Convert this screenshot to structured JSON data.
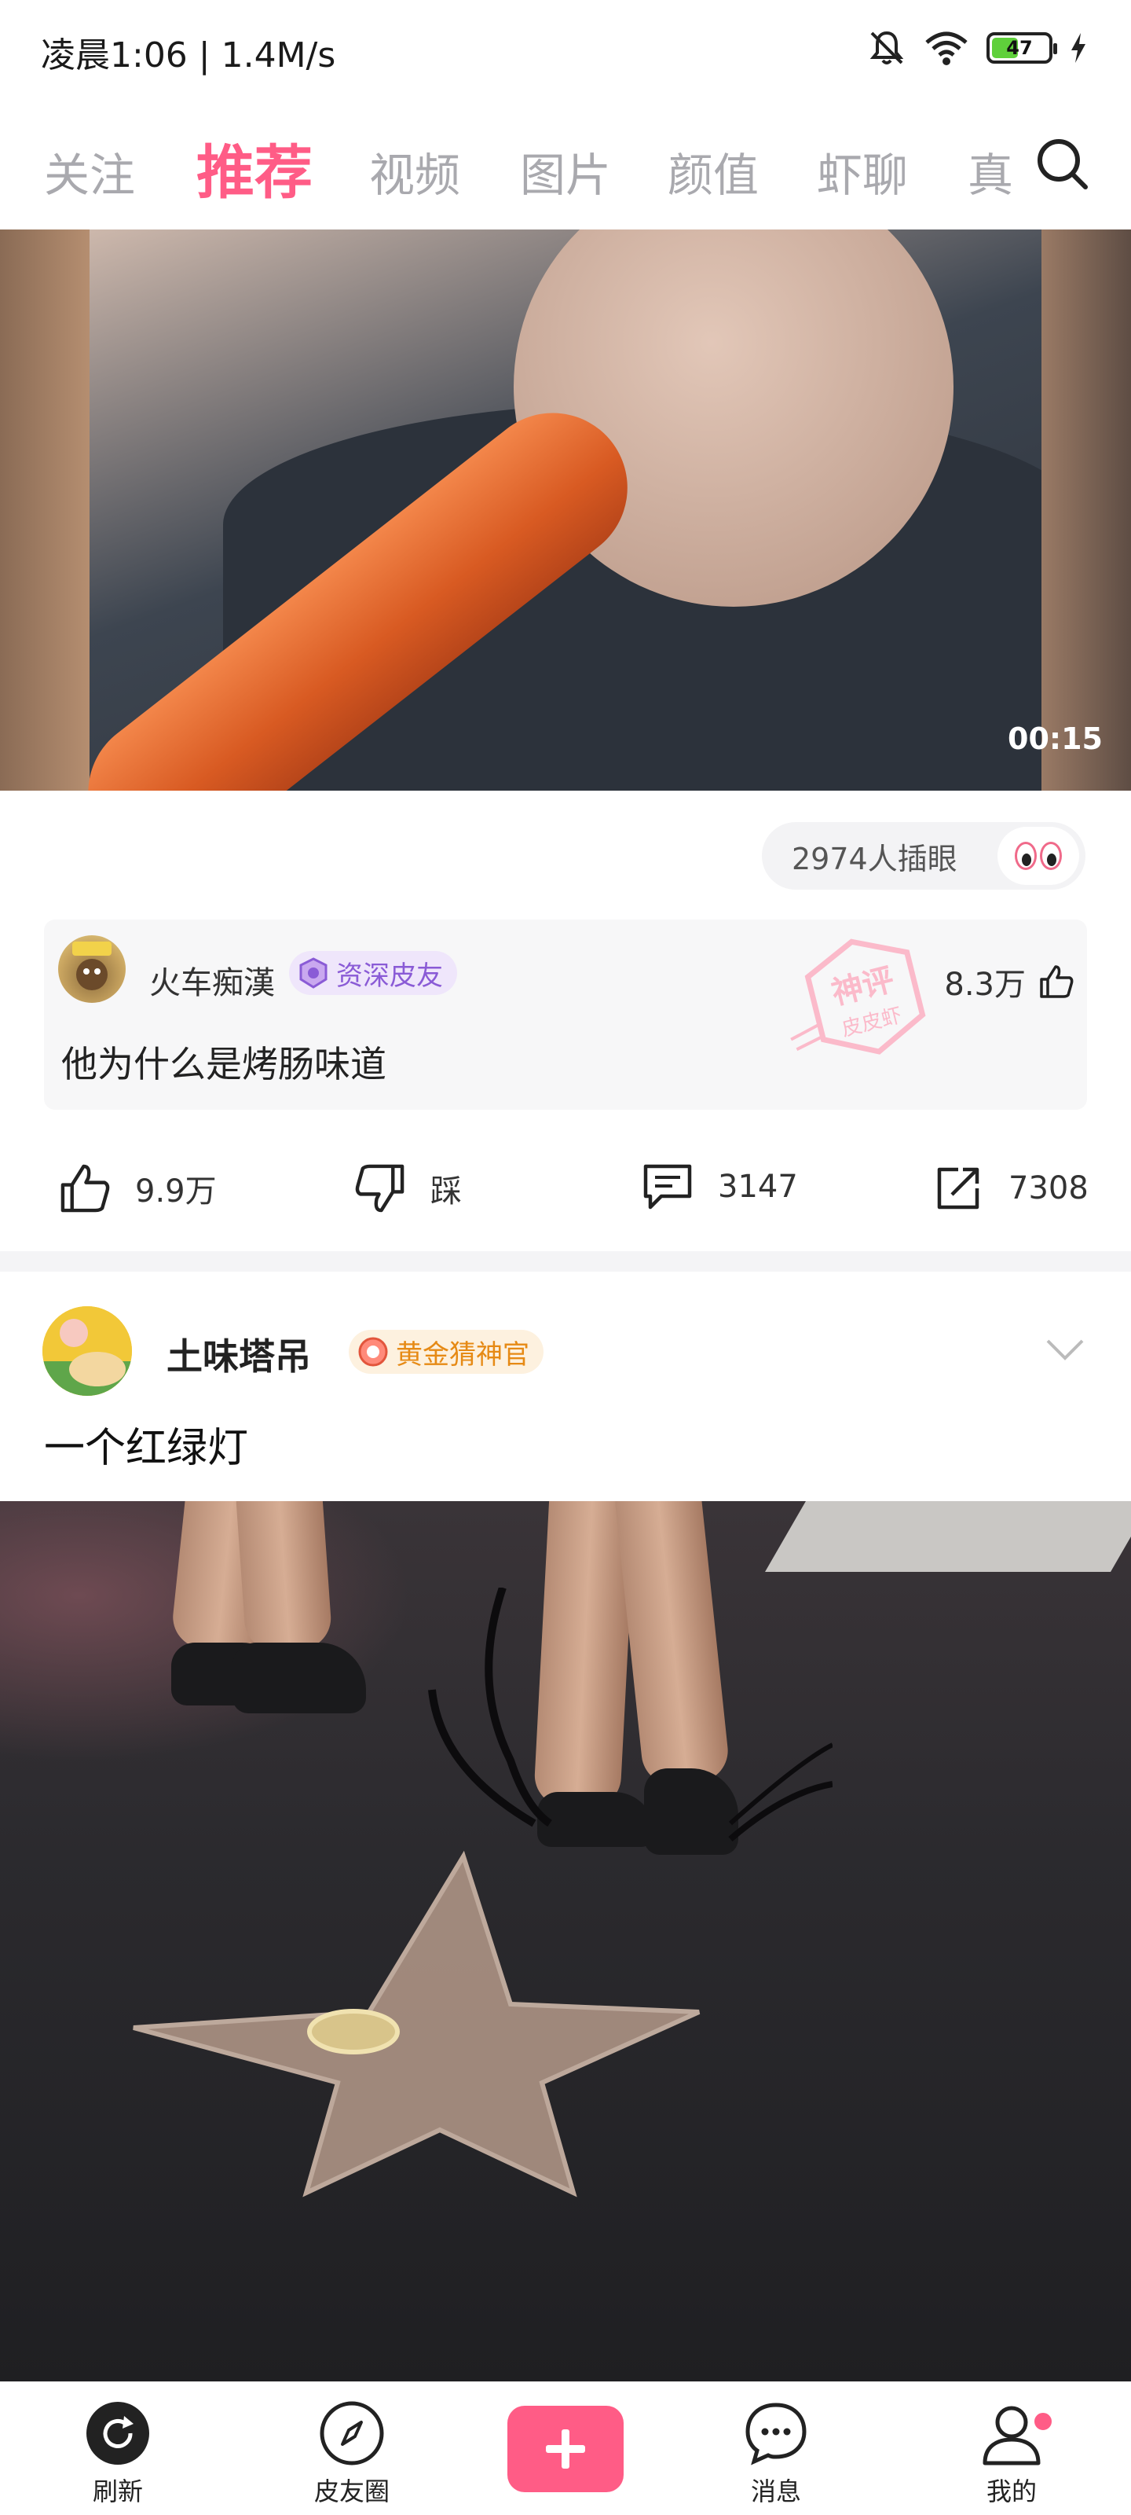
{
  "status_bar": {
    "time_speed": "凌晨1:06 | 1.4M/s",
    "battery": "47",
    "battery_level": 0.47
  },
  "tabs": [
    {
      "label": "关注",
      "active": false
    },
    {
      "label": "推荐",
      "active": true
    },
    {
      "label": "视频",
      "active": false
    },
    {
      "label": "图片",
      "active": false
    },
    {
      "label": "颜值",
      "active": false
    },
    {
      "label": "虾聊",
      "active": false
    },
    {
      "label": "真",
      "active": false
    }
  ],
  "post1": {
    "video_duration": "00:15",
    "viewers": "2974人插眼",
    "top_comment": {
      "author": "火车痴漢",
      "badge": "资深皮友",
      "likes": "8.3万",
      "text": "他为什么是烤肠味道",
      "stamp_text": [
        "神评",
        "皮皮虾"
      ]
    },
    "actions": {
      "likes": "9.9万",
      "dislike": "踩",
      "comments": "3147",
      "shares": "7308"
    }
  },
  "post2": {
    "author": "土味塔吊",
    "badge": "黄金猜神官",
    "text": "一个红绿灯"
  },
  "bottom_nav": {
    "refresh": "刷新",
    "circle": "皮友圈",
    "messages": "消息",
    "me": "我的"
  },
  "colors": {
    "accent": "#ff5c86",
    "badge_purple": "#8a5bd6",
    "badge_gold": "#e68a15"
  }
}
